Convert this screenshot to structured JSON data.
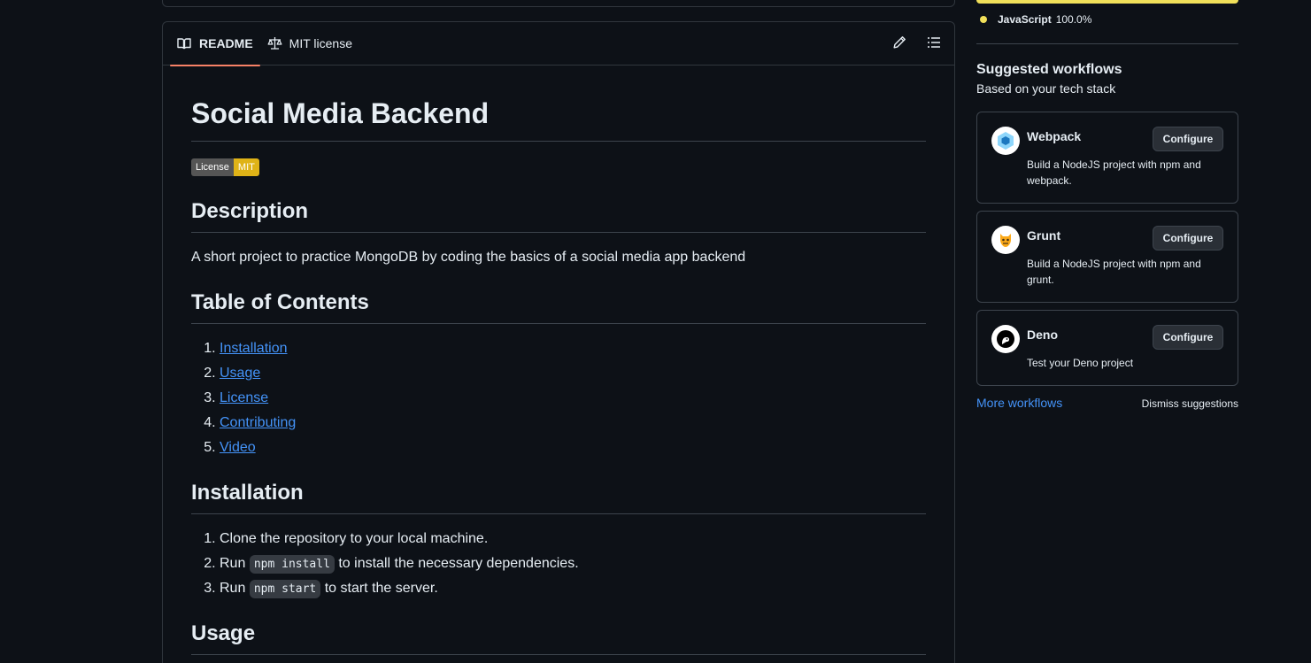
{
  "readme": {
    "tabs": [
      {
        "label": "README",
        "icon": "book-icon"
      },
      {
        "label": "MIT license",
        "icon": "law-icon"
      }
    ],
    "actions": [
      "pencil-icon",
      "list-unordered-icon"
    ],
    "title": "Social Media Backend",
    "badge": {
      "left": "License",
      "right": "MIT",
      "color": "#dfb317"
    },
    "description_heading": "Description",
    "description": "A short project to practice MongoDB by coding the basics of a social media app backend",
    "toc_heading": "Table of Contents",
    "toc": [
      "Installation",
      "Usage",
      "License",
      "Contributing",
      "Video"
    ],
    "installation_heading": "Installation",
    "installation": {
      "step1": "Clone the repository to your local machine.",
      "step2_pre": "Run",
      "step2_code": "npm install",
      "step2_post": "to install the necessary dependencies.",
      "step3_pre": "Run",
      "step3_code": "npm start",
      "step3_post": "to start the server."
    },
    "usage_heading": "Usage"
  },
  "sidebar": {
    "language": {
      "name": "JavaScript",
      "percent": "100.0%",
      "color": "#f1e05a"
    },
    "workflows_title": "Suggested workflows",
    "workflows_subtitle": "Based on your tech stack",
    "workflows": [
      {
        "name": "Webpack",
        "desc": "Build a NodeJS project with npm and webpack.",
        "button": "Configure",
        "icon": "webpack-icon"
      },
      {
        "name": "Grunt",
        "desc": "Build a NodeJS project with npm and grunt.",
        "button": "Configure",
        "icon": "grunt-icon"
      },
      {
        "name": "Deno",
        "desc": "Test your Deno project",
        "button": "Configure",
        "icon": "deno-icon"
      }
    ],
    "more_workflows": "More workflows",
    "dismiss": "Dismiss suggestions"
  }
}
